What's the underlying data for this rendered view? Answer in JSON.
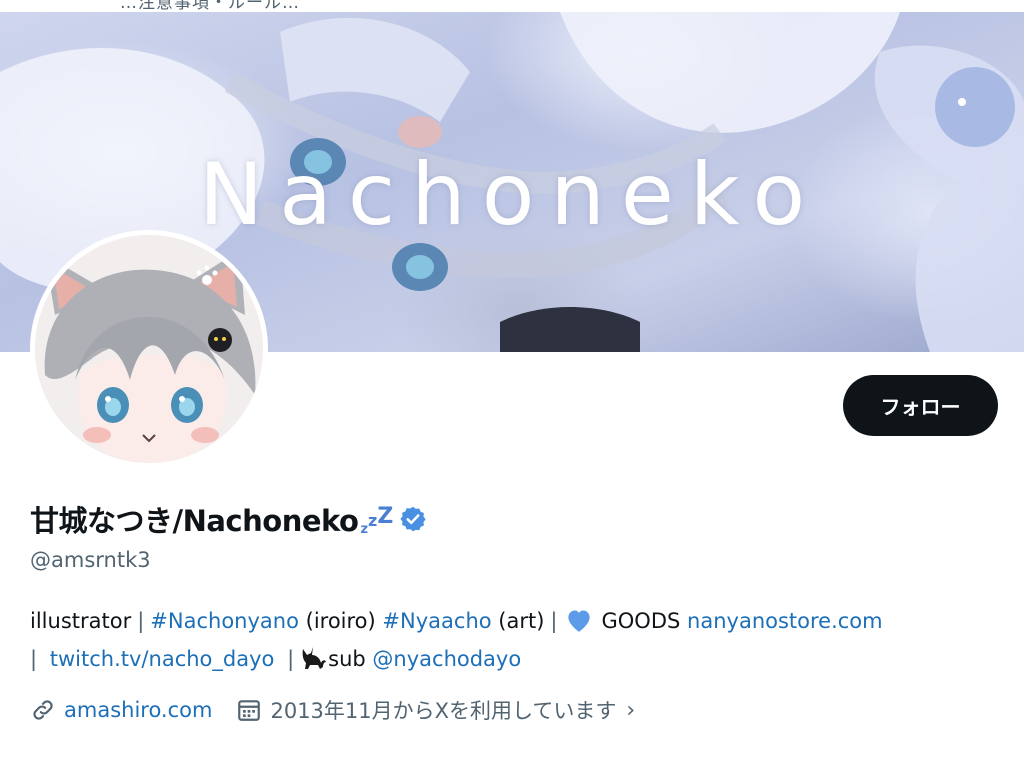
{
  "top_strip": {
    "text": "…注意事項・ルール…"
  },
  "banner": {
    "logo_text": "Nachoneko"
  },
  "profile": {
    "display_name": "甘城なつき/Nachoneko",
    "handle": "@amsrntk3",
    "follow_label": "フォロー",
    "verified": true
  },
  "bio": {
    "word_illustrator": "illustrator",
    "sep": "|",
    "tag1": "#Nachonyano",
    "tag1_note": "(iroiro)",
    "tag2": "#Nyaacho",
    "tag2_note": "(art)",
    "goods_label": "GOODS",
    "store_link": "nanyanostore.com",
    "twitch_link": "twitch.tv/nacho_dayo",
    "sub_label": "sub",
    "sub_handle": "@nyachodayo"
  },
  "meta": {
    "website": "amashiro.com",
    "joined": "2013年11月からXを利用しています"
  },
  "colors": {
    "link": "#1d6fb8",
    "muted": "#536471",
    "text": "#0f1419",
    "verified": "#4a90e2"
  }
}
